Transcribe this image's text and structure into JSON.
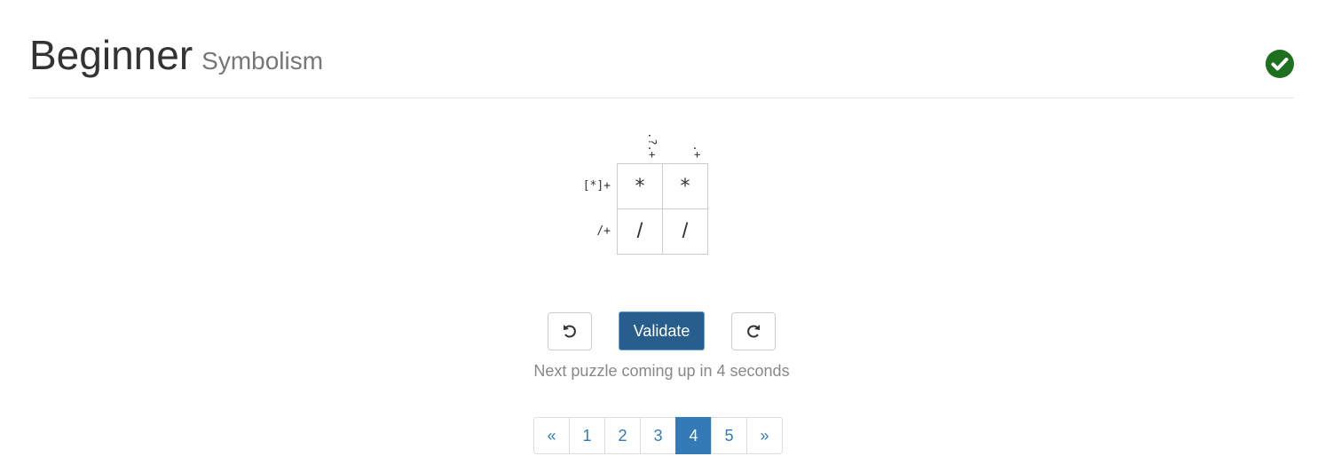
{
  "header": {
    "title": "Beginner",
    "subtitle": "Symbolism",
    "status_icon": "check-circle-icon",
    "status_color": "#1e6f1e"
  },
  "puzzle": {
    "column_clues": [
      ".?.+",
      ".+"
    ],
    "row_clues": [
      "[*]+",
      "/+"
    ],
    "grid": [
      [
        "*",
        "*"
      ],
      [
        "/",
        "/"
      ]
    ]
  },
  "controls": {
    "undo_icon": "undo-icon",
    "validate_label": "Validate",
    "redo_icon": "redo-icon",
    "validate_color": "#285e8e"
  },
  "status_text": "Next puzzle coming up in 4 seconds",
  "pagination": {
    "prev": "«",
    "pages": [
      "1",
      "2",
      "3",
      "4",
      "5"
    ],
    "next": "»",
    "active_page": "4",
    "accent_color": "#337ab7"
  }
}
